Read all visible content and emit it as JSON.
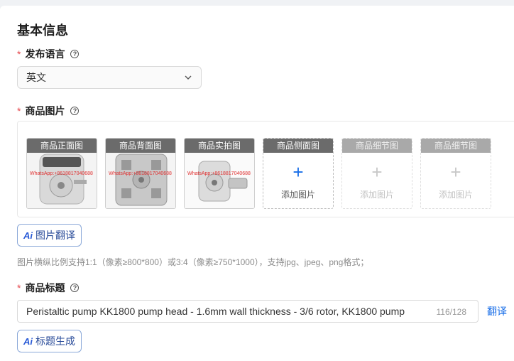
{
  "section": {
    "title": "基本信息"
  },
  "language": {
    "label": "发布语言",
    "required_mark": "*",
    "help_icon": "question-circle-icon",
    "value": "英文"
  },
  "images": {
    "label": "商品图片",
    "required_mark": "*",
    "slots": [
      {
        "tag": "商品正面图",
        "state": "filled",
        "watermark": "WhatsApp:+8618817040688"
      },
      {
        "tag": "商品背面图",
        "state": "filled",
        "watermark": "WhatsApp:+8618817040688"
      },
      {
        "tag": "商品实拍图",
        "state": "filled",
        "watermark": "WhatsApp:+8618817040688"
      },
      {
        "tag": "商品侧面图",
        "state": "empty",
        "add_label": "添加图片"
      },
      {
        "tag": "商品细节图",
        "state": "disabled",
        "add_label": "添加图片"
      },
      {
        "tag": "商品细节图",
        "state": "disabled",
        "add_label": "添加图片"
      }
    ],
    "translate_button": {
      "badge": "Ai",
      "label": "图片翻译"
    },
    "hint": "图片横纵比例支持1:1（像素≥800*800）或3:4（像素≥750*1000），支持jpg、jpeg、png格式；"
  },
  "title": {
    "label": "商品标题",
    "required_mark": "*",
    "value": "Peristaltic pump KK1800 pump head - 1.6mm wall thickness - 3/6 rotor, KK1800 pump",
    "counter": "116/128",
    "translate_link": "翻译",
    "generate_button": {
      "badge": "Ai",
      "label": "标题生成"
    }
  },
  "colors": {
    "accent": "#1a6fe8",
    "required": "#e5484d",
    "tag_bg": "#6b6b6b"
  }
}
